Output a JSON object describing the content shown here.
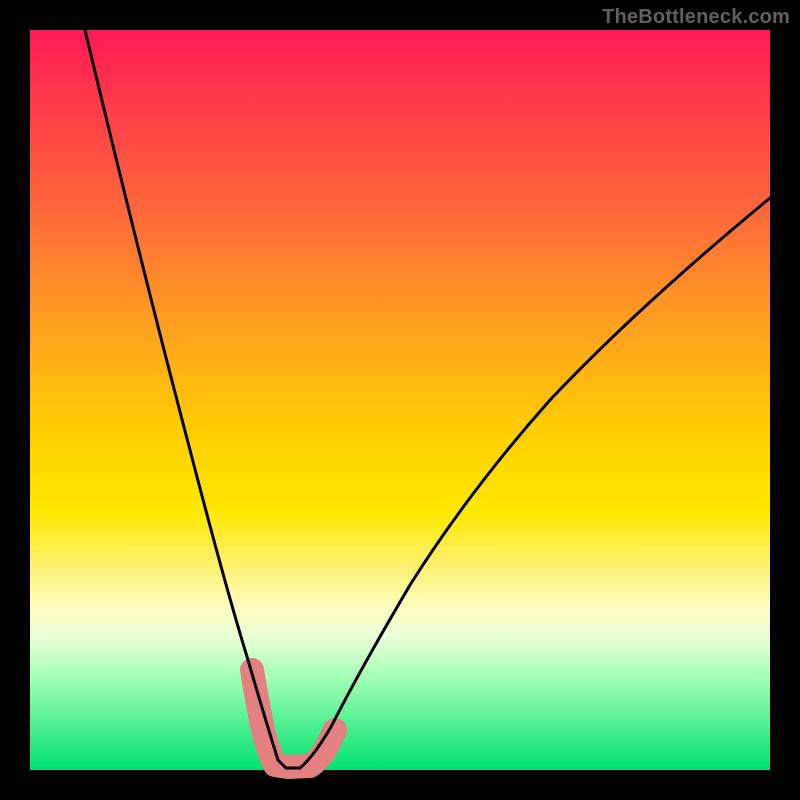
{
  "watermark": "TheBottleneck.com",
  "chart_data": {
    "type": "line",
    "title": "",
    "xlabel": "",
    "ylabel": "",
    "xlim": [
      0,
      100
    ],
    "ylim": [
      0,
      100
    ],
    "background_gradient": {
      "top": "#ff1a55",
      "mid": "#ffe800",
      "bottom": "#00e070",
      "meaning": "higher position = higher bottleneck percentage (worse); bottom = no bottleneck (good)"
    },
    "series": [
      {
        "name": "bottleneck-curve",
        "description": "V-shaped bottleneck curve; minimum near x≈34 at y≈0",
        "approx_points": [
          {
            "x": 7,
            "y": 100
          },
          {
            "x": 15,
            "y": 75
          },
          {
            "x": 22,
            "y": 45
          },
          {
            "x": 27,
            "y": 25
          },
          {
            "x": 30,
            "y": 13
          },
          {
            "x": 32,
            "y": 5
          },
          {
            "x": 34,
            "y": 0
          },
          {
            "x": 38,
            "y": 1
          },
          {
            "x": 41,
            "y": 5
          },
          {
            "x": 45,
            "y": 13
          },
          {
            "x": 55,
            "y": 32
          },
          {
            "x": 70,
            "y": 53
          },
          {
            "x": 85,
            "y": 68
          },
          {
            "x": 100,
            "y": 78
          }
        ]
      },
      {
        "name": "highlight-band",
        "description": "pink/salmon thick segment near trough indicating the optimal region",
        "color": "#e58080",
        "approx_points": [
          {
            "x": 30,
            "y": 13
          },
          {
            "x": 31,
            "y": 8
          },
          {
            "x": 32,
            "y": 4
          },
          {
            "x": 33,
            "y": 1
          },
          {
            "x": 35,
            "y": 0
          },
          {
            "x": 37,
            "y": 0.5
          },
          {
            "x": 39,
            "y": 2
          },
          {
            "x": 41,
            "y": 5
          }
        ]
      }
    ]
  }
}
